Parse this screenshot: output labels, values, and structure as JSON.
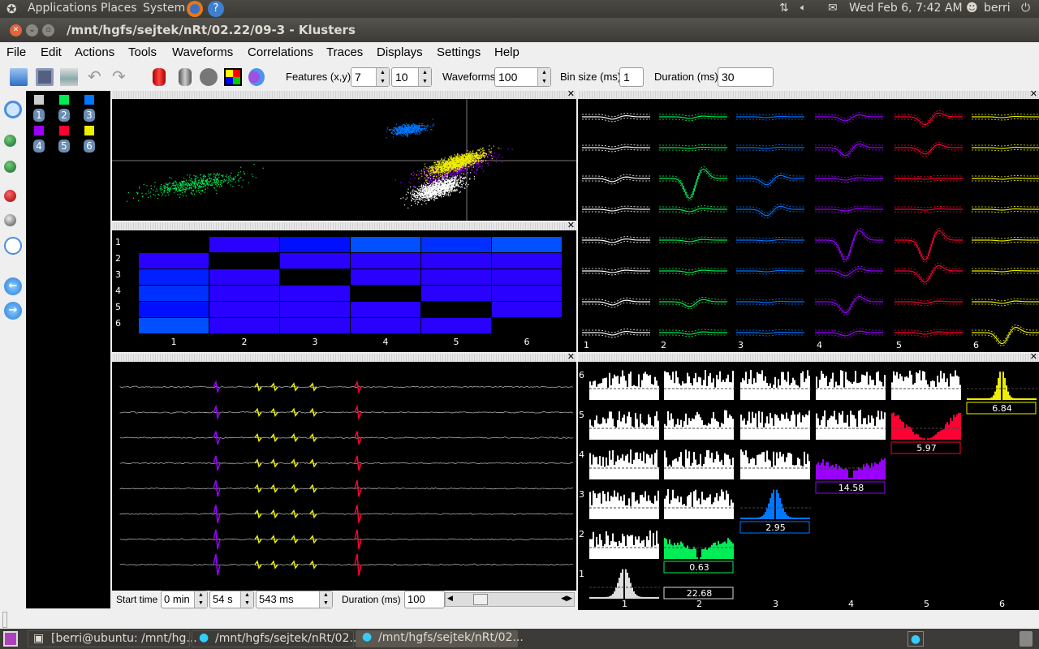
{
  "top_panel": {
    "menus": [
      "Applications",
      "Places",
      "System"
    ],
    "datetime": "Wed Feb  6,  7:42 AM",
    "user": "berri"
  },
  "window": {
    "title": "/mnt/hgfs/sejtek/nRt/02.22/09-3 - Klusters"
  },
  "menubar": [
    "File",
    "Edit",
    "Actions",
    "Tools",
    "Waveforms",
    "Correlations",
    "Traces",
    "Displays",
    "Settings",
    "Help"
  ],
  "toolbar": {
    "features_label": "Features (x,y)",
    "feature_x": "7",
    "feature_y": "10",
    "waveforms_label": "Waveforms",
    "waveforms": "100",
    "binsize_label": "Bin size (ms)",
    "binsize": "1",
    "duration_label": "Duration (ms)",
    "duration": "30",
    "icons": [
      "open-icon",
      "save-icon",
      "print-icon",
      "undo-icon",
      "redo-icon",
      "red-cylinder-icon",
      "grey-cylinder-icon",
      "grey-circle-icon",
      "color-grid-icon",
      "cluster-overlap-icon"
    ]
  },
  "left_tools": [
    "zoom-icon",
    "new-cluster-icon",
    "new-clusters-icon",
    "delete-artifact-icon",
    "delete-noise-icon",
    "time-icon",
    "previous-icon",
    "next-icon"
  ],
  "clusters": [
    {
      "id": "1",
      "color": "#cccccc"
    },
    {
      "id": "2",
      "color": "#00ee55"
    },
    {
      "id": "3",
      "color": "#0077ff"
    },
    {
      "id": "4",
      "color": "#9900ff"
    },
    {
      "id": "5",
      "color": "#ff0033"
    },
    {
      "id": "6",
      "color": "#eeee00"
    }
  ],
  "error_matrix": {
    "row_labels": [
      "1",
      "2",
      "3",
      "4",
      "5",
      "6"
    ],
    "col_labels": [
      "1",
      "2",
      "3",
      "4",
      "5",
      "6"
    ],
    "colors": [
      [
        "#000000",
        "#2a00ff",
        "#0010ff",
        "#0050ff",
        "#0030ff",
        "#0050ff"
      ],
      [
        "#2a00ff",
        "#000000",
        "#2a00ff",
        "#2a00ff",
        "#2a00ff",
        "#2a00ff"
      ],
      [
        "#0020ff",
        "#2a00ff",
        "#000000",
        "#2a00ff",
        "#2a00ff",
        "#2a00ff"
      ],
      [
        "#0030ff",
        "#2a00ff",
        "#2a00ff",
        "#000000",
        "#2a00ff",
        "#2a00ff"
      ],
      [
        "#0010ff",
        "#2a00ff",
        "#2a00ff",
        "#2a00ff",
        "#000000",
        "#2a00ff"
      ],
      [
        "#0050ff",
        "#2a00ff",
        "#2a00ff",
        "#2a00ff",
        "#2a00ff",
        null
      ]
    ]
  },
  "waveforms": {
    "col_labels": [
      "1",
      "2",
      "3",
      "4",
      "5",
      "6"
    ]
  },
  "correlograms": {
    "row_labels": [
      "6",
      "5",
      "4",
      "3",
      "2",
      "1"
    ],
    "col_labels": [
      "1",
      "2",
      "3",
      "4",
      "5",
      "6"
    ],
    "values": {
      "1": "22.68",
      "2": "0.63",
      "3": "2.95",
      "4": "14.58",
      "5": "5.97",
      "6": "6.84"
    }
  },
  "traces_controls": {
    "start_label": "Start time",
    "min": "0 min",
    "s": "54 s",
    "ms": "543 ms",
    "duration_label": "Duration (ms)",
    "duration": "100"
  },
  "taskbar": [
    "[berri@ubuntu: /mnt/hg...",
    "/mnt/hgfs/sejtek/nRt/02...",
    "/mnt/hgfs/sejtek/nRt/02..."
  ]
}
